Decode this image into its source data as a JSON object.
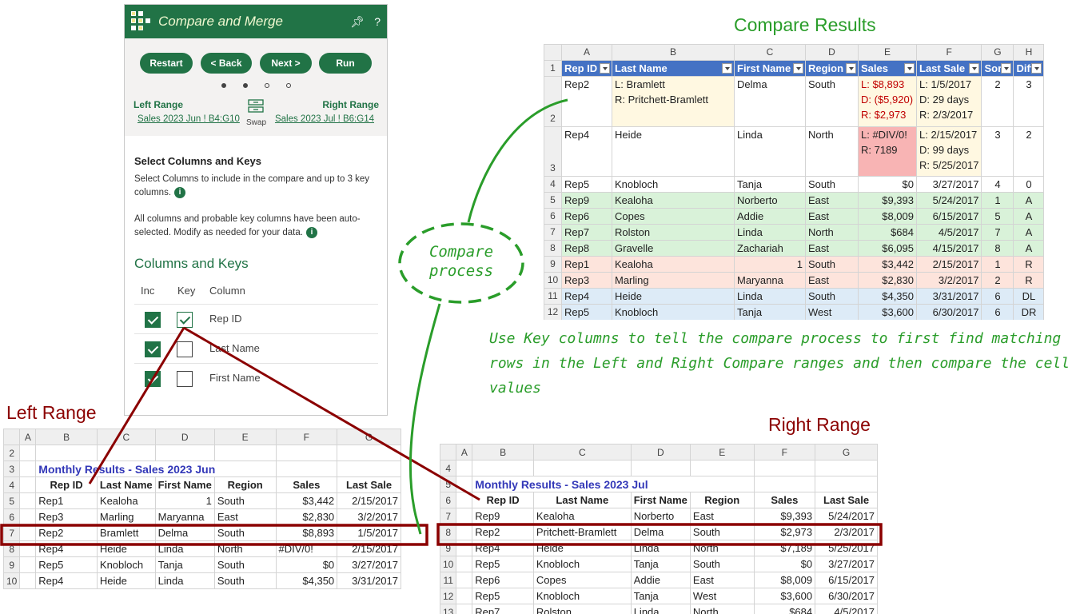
{
  "pane": {
    "title": "Compare and Merge",
    "pin_icon": "pin-icon",
    "help": "?",
    "buttons": {
      "restart": "Restart",
      "back": "< Back",
      "next": "Next >",
      "run": "Run"
    },
    "left_range_label": "Left Range",
    "right_range_label": "Right Range",
    "left_range_link": "Sales 2023 Jun ! B4:G10",
    "right_range_link": "Sales 2023 Jul ! B6:G14",
    "swap_label": "Swap",
    "section_title": "Select Columns and Keys",
    "desc1": "Select Columns to include in the compare and up to 3 key columns.",
    "desc2": "All columns and probable key columns have been auto-selected. Modify as needed for your data.",
    "info_icon": "i",
    "columns_title": "Columns and Keys",
    "col_headers": {
      "inc": "Inc",
      "key": "Key",
      "column": "Column"
    },
    "rows": [
      {
        "name": "Rep ID",
        "inc": true,
        "key": true
      },
      {
        "name": "Last Name",
        "inc": true,
        "key": false
      },
      {
        "name": "First Name",
        "inc": true,
        "key": false
      }
    ]
  },
  "results": {
    "title": "Compare Results",
    "col_letters": [
      "A",
      "B",
      "C",
      "D",
      "E",
      "F",
      "G",
      "H"
    ],
    "headers": [
      "Rep ID",
      "Last Name",
      "First Name",
      "Region",
      "Sales",
      "Last Sale",
      "Sort",
      "Diff"
    ],
    "rows": [
      {
        "n": "2",
        "rep": "Rep2",
        "last": [
          "L: Bramlett",
          "R: Pritchett-Bramlett"
        ],
        "first": "Delma",
        "region": "South",
        "sales": [
          "L: $8,893",
          "D: ($5,920)",
          "R: $2,973"
        ],
        "lastsale": [
          "L: 1/5/2017",
          "D: 29 days",
          "R: 2/3/2017"
        ],
        "sort": "2",
        "diff": "3"
      },
      {
        "n": "3",
        "rep": "Rep4",
        "last": [
          "Heide"
        ],
        "first": "Linda",
        "region": "North",
        "sales": [
          "L: #DIV/0!",
          "R: 7189"
        ],
        "lastsale": [
          "L: 2/15/2017",
          "D: 99 days",
          "R: 5/25/2017"
        ],
        "sort": "3",
        "diff": "2"
      },
      {
        "n": "4",
        "rep": "Rep5",
        "last": [
          "Knobloch"
        ],
        "first": "Tanja",
        "region": "South",
        "sales": [
          "$0"
        ],
        "lastsale": [
          "3/27/2017"
        ],
        "sort": "4",
        "diff": "0"
      },
      {
        "n": "5",
        "rep": "Rep9",
        "last": [
          "Kealoha"
        ],
        "first": "Norberto",
        "region": "East",
        "sales": [
          "$9,393"
        ],
        "lastsale": [
          "5/24/2017"
        ],
        "sort": "1",
        "diff": "A"
      },
      {
        "n": "6",
        "rep": "Rep6",
        "last": [
          "Copes"
        ],
        "first": "Addie",
        "region": "East",
        "sales": [
          "$8,009"
        ],
        "lastsale": [
          "6/15/2017"
        ],
        "sort": "5",
        "diff": "A"
      },
      {
        "n": "7",
        "rep": "Rep7",
        "last": [
          "Rolston"
        ],
        "first": "Linda",
        "region": "North",
        "sales": [
          "$684"
        ],
        "lastsale": [
          "4/5/2017"
        ],
        "sort": "7",
        "diff": "A"
      },
      {
        "n": "8",
        "rep": "Rep8",
        "last": [
          "Gravelle"
        ],
        "first": "Zachariah",
        "region": "East",
        "sales": [
          "$6,095"
        ],
        "lastsale": [
          "4/15/2017"
        ],
        "sort": "8",
        "diff": "A"
      },
      {
        "n": "9",
        "rep": "Rep1",
        "last": [
          "Kealoha"
        ],
        "first": "1",
        "region": "South",
        "sales": [
          "$3,442"
        ],
        "lastsale": [
          "2/15/2017"
        ],
        "sort": "1",
        "diff": "R"
      },
      {
        "n": "10",
        "rep": "Rep3",
        "last": [
          "Marling"
        ],
        "first": "Maryanna",
        "region": "East",
        "sales": [
          "$2,830"
        ],
        "lastsale": [
          "3/2/2017"
        ],
        "sort": "2",
        "diff": "R"
      },
      {
        "n": "11",
        "rep": "Rep4",
        "last": [
          "Heide"
        ],
        "first": "Linda",
        "region": "South",
        "sales": [
          "$4,350"
        ],
        "lastsale": [
          "3/31/2017"
        ],
        "sort": "6",
        "diff": "DL"
      },
      {
        "n": "12",
        "rep": "Rep5",
        "last": [
          "Knobloch"
        ],
        "first": "Tanja",
        "region": "West",
        "sales": [
          "$3,600"
        ],
        "lastsale": [
          "6/30/2017"
        ],
        "sort": "6",
        "diff": "DR"
      }
    ]
  },
  "note": "Use Key columns to tell the compare process to first find matching rows in the Left and Right Compare ranges and then compare the cell values",
  "compare_process": "Compare process",
  "left": {
    "heading": "Left Range",
    "col_letters": [
      "A",
      "B",
      "C",
      "D",
      "E",
      "F",
      "G"
    ],
    "title": "Monthly Results - Sales 2023 Jun",
    "headers": [
      "Rep ID",
      "Last Name",
      "First Name",
      "Region",
      "Sales",
      "Last Sale"
    ],
    "rows": [
      [
        "5",
        "Rep1",
        "Kealoha",
        "1",
        "South",
        "$3,442",
        "2/15/2017"
      ],
      [
        "6",
        "Rep3",
        "Marling",
        "Maryanna",
        "East",
        "$2,830",
        "3/2/2017"
      ],
      [
        "7",
        "Rep2",
        "Bramlett",
        "Delma",
        "South",
        "$8,893",
        "1/5/2017"
      ],
      [
        "8",
        "Rep4",
        "Heide",
        "Linda",
        "North",
        "#DIV/0!",
        "2/15/2017"
      ],
      [
        "9",
        "Rep5",
        "Knobloch",
        "Tanja",
        "South",
        "$0",
        "3/27/2017"
      ],
      [
        "10",
        "Rep4",
        "Heide",
        "Linda",
        "South",
        "$4,350",
        "3/31/2017"
      ]
    ]
  },
  "right": {
    "heading": "Right Range",
    "col_letters": [
      "A",
      "B",
      "C",
      "D",
      "E",
      "F",
      "G"
    ],
    "title": "Monthly Results - Sales 2023 Jul",
    "headers": [
      "Rep ID",
      "Last Name",
      "First Name",
      "Region",
      "Sales",
      "Last Sale"
    ],
    "rows": [
      [
        "7",
        "Rep9",
        "Kealoha",
        "Norberto",
        "East",
        "$9,393",
        "5/24/2017"
      ],
      [
        "8",
        "Rep2",
        "Pritchett-Bramlett",
        "Delma",
        "South",
        "$2,973",
        "2/3/2017"
      ],
      [
        "9",
        "Rep4",
        "Heide",
        "Linda",
        "North",
        "$7,189",
        "5/25/2017"
      ],
      [
        "10",
        "Rep5",
        "Knobloch",
        "Tanja",
        "South",
        "$0",
        "3/27/2017"
      ],
      [
        "11",
        "Rep6",
        "Copes",
        "Addie",
        "East",
        "$8,009",
        "6/15/2017"
      ],
      [
        "12",
        "Rep5",
        "Knobloch",
        "Tanja",
        "West",
        "$3,600",
        "6/30/2017"
      ],
      [
        "13",
        "Rep7",
        "Rolston",
        "Linda",
        "North",
        "$684",
        "4/5/2017"
      ]
    ]
  },
  "colors": {
    "green": "#217346",
    "accent_green": "#2a9d2a",
    "dark_red": "#8b0000",
    "header_blue": "#4472c4"
  }
}
